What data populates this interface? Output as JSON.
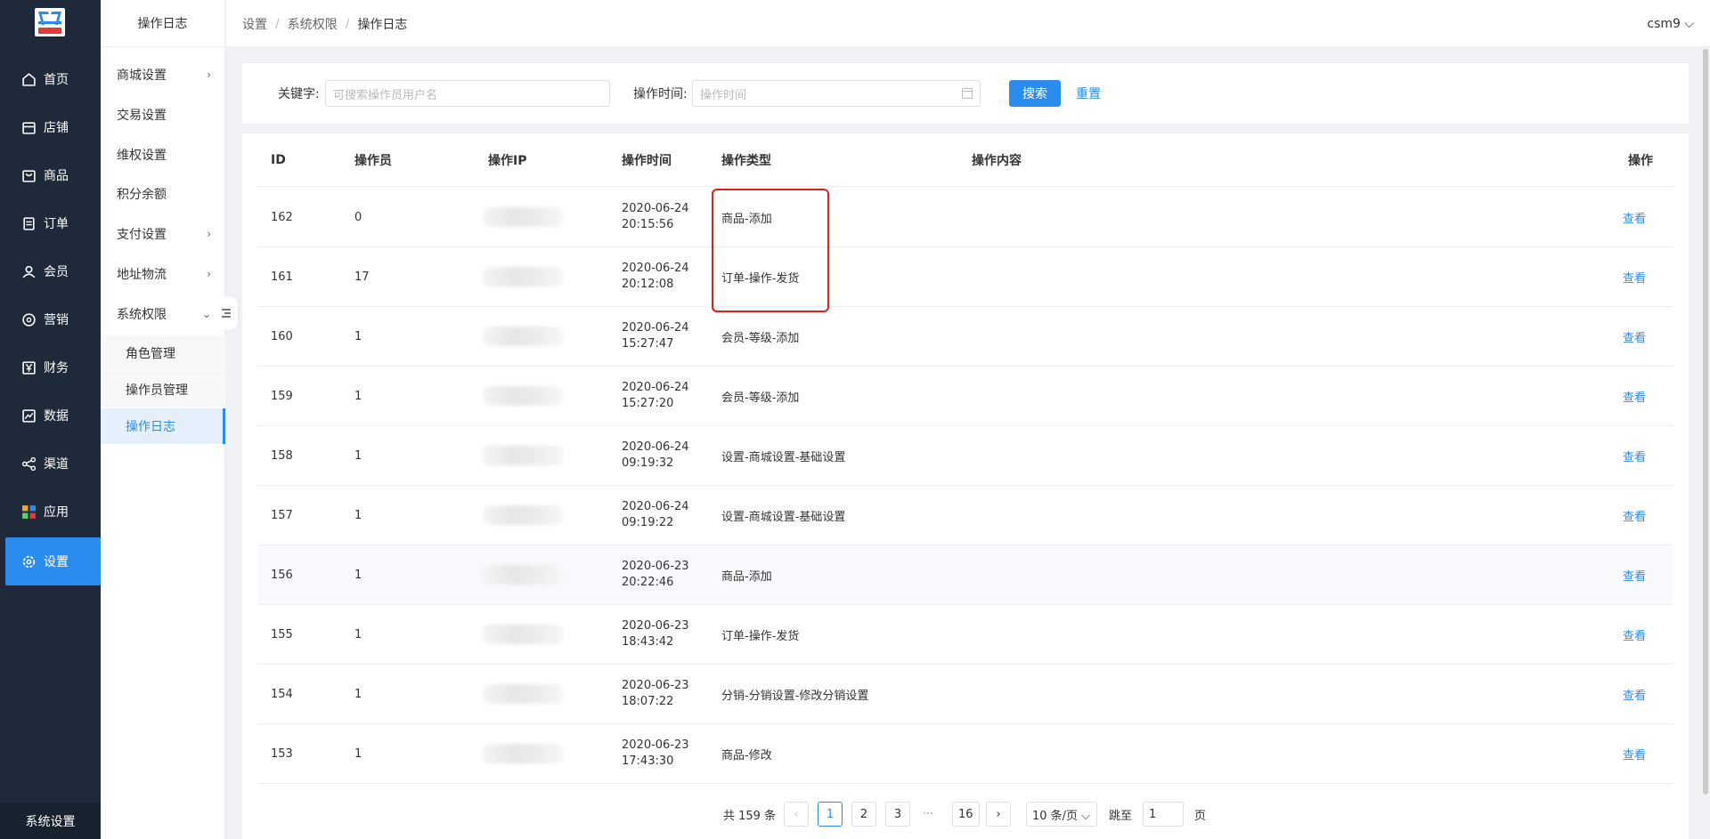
{
  "nav": {
    "items": [
      {
        "label": "首页",
        "icon": "home-icon"
      },
      {
        "label": "店铺",
        "icon": "store-icon"
      },
      {
        "label": "商品",
        "icon": "shopping-bag-icon"
      },
      {
        "label": "订单",
        "icon": "order-icon"
      },
      {
        "label": "会员",
        "icon": "user-icon"
      },
      {
        "label": "营销",
        "icon": "marketing-icon"
      },
      {
        "label": "财务",
        "icon": "yen-icon"
      },
      {
        "label": "数据",
        "icon": "chart-icon"
      },
      {
        "label": "渠道",
        "icon": "share-icon"
      },
      {
        "label": "应用",
        "icon": "apps-icon"
      },
      {
        "label": "设置",
        "icon": "gear-icon"
      }
    ],
    "bottom_label": "系统设置",
    "active_color": "#2b8cef"
  },
  "subnav": {
    "title": "操作日志",
    "items": [
      {
        "label": "商城设置",
        "chevron": "›"
      },
      {
        "label": "交易设置",
        "chevron": ""
      },
      {
        "label": "维权设置",
        "chevron": ""
      },
      {
        "label": "积分余额",
        "chevron": ""
      },
      {
        "label": "支付设置",
        "chevron": "›"
      },
      {
        "label": "地址物流",
        "chevron": "›"
      },
      {
        "label": "系统权限",
        "chevron": "⌄"
      }
    ],
    "children": [
      {
        "label": "角色管理"
      },
      {
        "label": "操作员管理"
      },
      {
        "label": "操作日志"
      }
    ]
  },
  "header": {
    "breadcrumb": [
      "设置",
      "系统权限",
      "操作日志"
    ],
    "separator": "/",
    "user": "csm9 ⌵"
  },
  "filter": {
    "keyword_label": "关键字:",
    "keyword_placeholder": "可搜索操作员用户名",
    "time_label": "操作时间:",
    "time_placeholder": "操作时间",
    "search_label": "搜索",
    "reset_label": "重置"
  },
  "table": {
    "headers": [
      "ID",
      "操作员",
      "操作IP",
      "操作时间",
      "操作类型",
      "操作内容",
      "操作"
    ],
    "rows": [
      {
        "id": "162",
        "operator": "0",
        "date": "2020-06-24",
        "time": "20:15:56",
        "type": "商品-添加",
        "action": "查看"
      },
      {
        "id": "161",
        "operator": "17",
        "date": "2020-06-24",
        "time": "20:12:08",
        "type": "订单-操作-发货",
        "action": "查看"
      },
      {
        "id": "160",
        "operator": "1",
        "date": "2020-06-24",
        "time": "15:27:47",
        "type": "会员-等级-添加",
        "action": "查看"
      },
      {
        "id": "159",
        "operator": "1",
        "date": "2020-06-24",
        "time": "15:27:20",
        "type": "会员-等级-添加",
        "action": "查看"
      },
      {
        "id": "158",
        "operator": "1",
        "date": "2020-06-24",
        "time": "09:19:32",
        "type": "设置-商城设置-基础设置",
        "action": "查看"
      },
      {
        "id": "157",
        "operator": "1",
        "date": "2020-06-24",
        "time": "09:19:22",
        "type": "设置-商城设置-基础设置",
        "action": "查看"
      },
      {
        "id": "156",
        "operator": "1",
        "date": "2020-06-23",
        "time": "20:22:46",
        "type": "商品-添加",
        "action": "查看"
      },
      {
        "id": "155",
        "operator": "1",
        "date": "2020-06-23",
        "time": "18:43:42",
        "type": "订单-操作-发货",
        "action": "查看"
      },
      {
        "id": "154",
        "operator": "1",
        "date": "2020-06-23",
        "time": "18:07:22",
        "type": "分销-分销设置-修改分销设置",
        "action": "查看"
      },
      {
        "id": "153",
        "operator": "1",
        "date": "2020-06-23",
        "time": "17:43:30",
        "type": "商品-修改",
        "action": "查看"
      }
    ]
  },
  "pagination": {
    "total": "共 159 条",
    "prev": "‹",
    "pages": [
      "1",
      "2",
      "3"
    ],
    "dots": "···",
    "last_page": "16",
    "next": "›",
    "page_size": "10 条/页 ⌵",
    "goto_label": "跳至",
    "goto_value": "1",
    "goto_suffix": "页"
  }
}
